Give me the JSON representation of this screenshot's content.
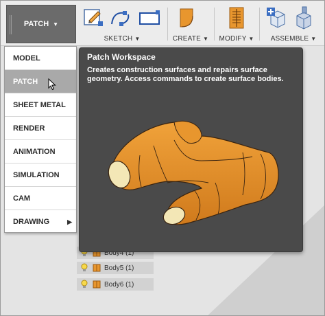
{
  "toolbar": {
    "workspace_label": "PATCH",
    "groups": [
      {
        "label": "SKETCH"
      },
      {
        "label": "CREATE"
      },
      {
        "label": "MODIFY"
      },
      {
        "label": "ASSEMBLE"
      }
    ]
  },
  "menu": {
    "items": [
      {
        "label": "MODEL"
      },
      {
        "label": "PATCH"
      },
      {
        "label": "SHEET METAL"
      },
      {
        "label": "RENDER"
      },
      {
        "label": "ANIMATION"
      },
      {
        "label": "SIMULATION"
      },
      {
        "label": "CAM"
      },
      {
        "label": "DRAWING"
      }
    ],
    "selected": "PATCH"
  },
  "tooltip": {
    "title": "Patch Workspace",
    "body": "Creates construction surfaces and repairs surface geometry. Access commands to create surface bodies."
  },
  "browser": {
    "bodies": [
      {
        "label": "Body4 (1)"
      },
      {
        "label": "Body5 (1)"
      },
      {
        "label": "Body6 (1)"
      }
    ]
  },
  "colors": {
    "accent_orange": "#e8962e",
    "tooltip_bg": "#4a4a4a",
    "menu_active": "#a9a9a9"
  }
}
